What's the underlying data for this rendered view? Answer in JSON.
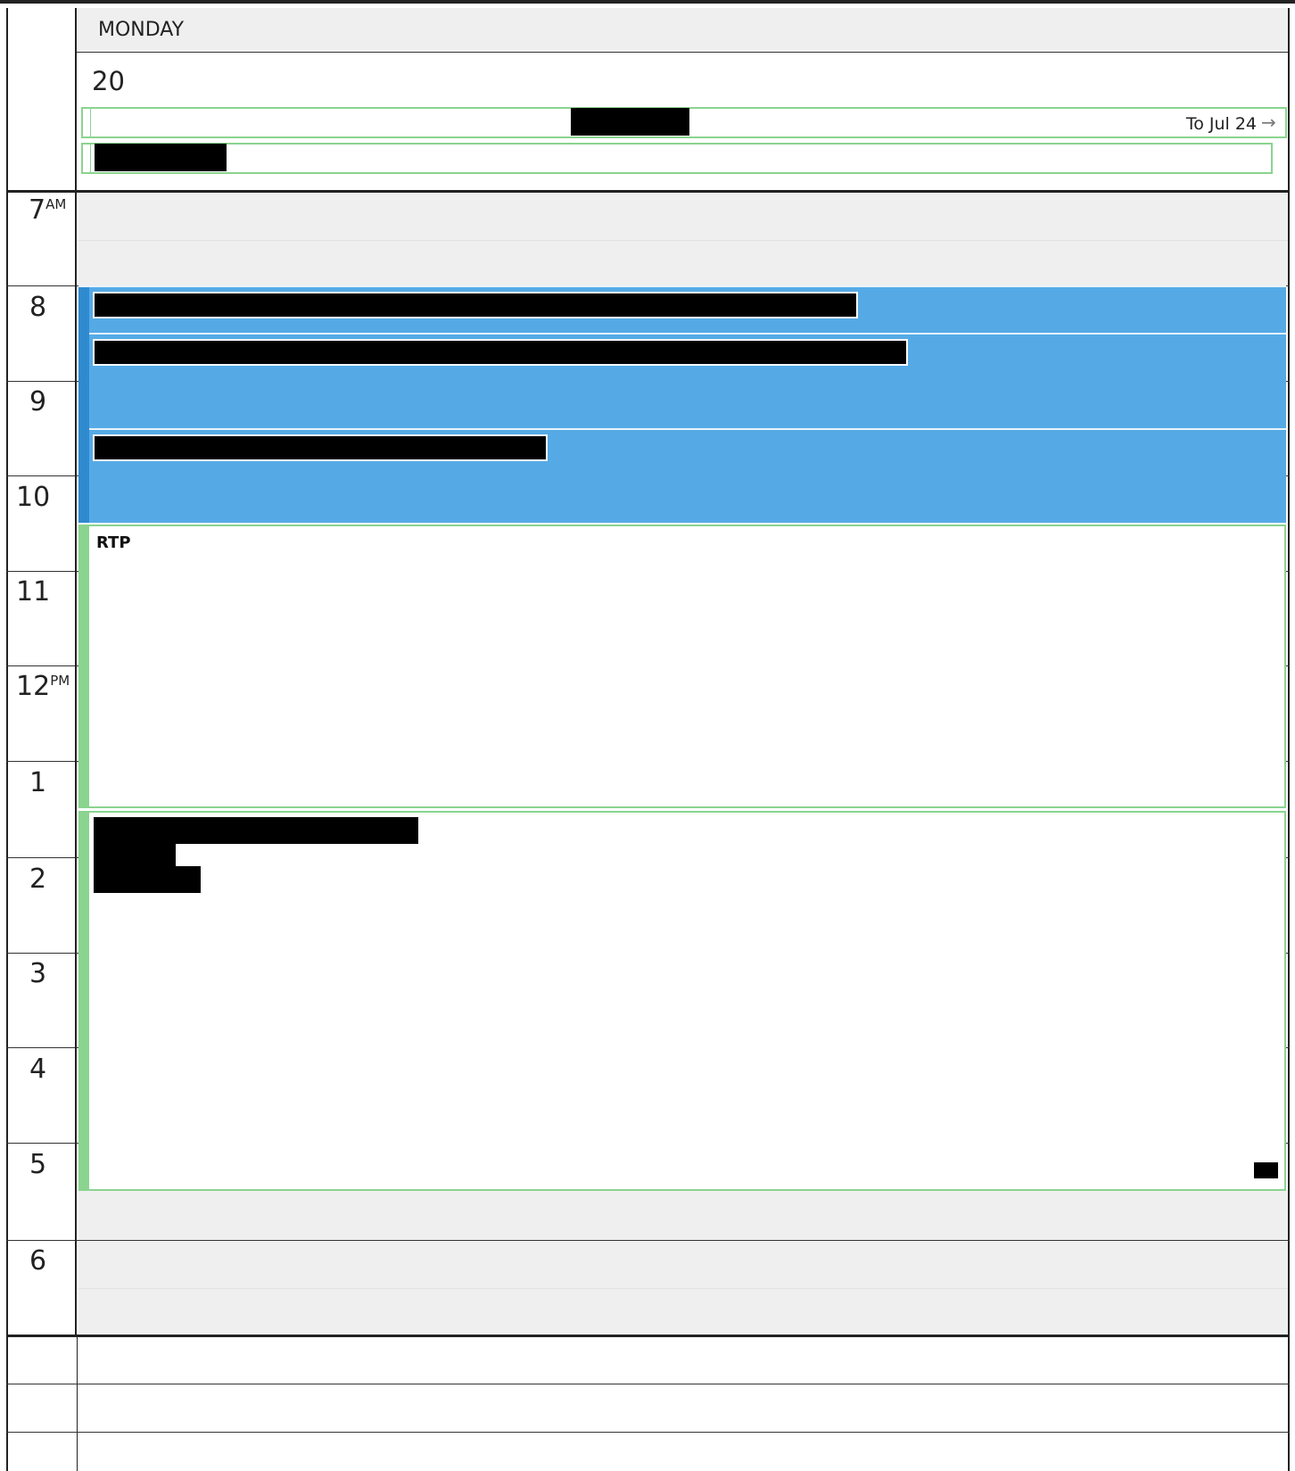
{
  "header": {
    "day_name": "MONDAY",
    "day_number": "20",
    "all_day_events": [
      {
        "title": "",
        "continues_to": "To Jul 24",
        "arrow": "→"
      },
      {
        "title": ""
      }
    ]
  },
  "time_slots": [
    {
      "hour": "7",
      "suffix": "AM"
    },
    {
      "hour": "8",
      "suffix": ""
    },
    {
      "hour": "9",
      "suffix": ""
    },
    {
      "hour": "10",
      "suffix": ""
    },
    {
      "hour": "11",
      "suffix": ""
    },
    {
      "hour": "12",
      "suffix": "PM"
    },
    {
      "hour": "1",
      "suffix": ""
    },
    {
      "hour": "2",
      "suffix": ""
    },
    {
      "hour": "3",
      "suffix": ""
    },
    {
      "hour": "4",
      "suffix": ""
    },
    {
      "hour": "5",
      "suffix": ""
    },
    {
      "hour": "6",
      "suffix": ""
    }
  ],
  "events": [
    {
      "title": "",
      "style": "busy"
    },
    {
      "title": "",
      "style": "busy"
    },
    {
      "title": "",
      "style": "busy"
    },
    {
      "title": "RTP",
      "style": "free"
    },
    {
      "title": "",
      "style": "free"
    }
  ],
  "colors": {
    "busy_fill": "#55aae6",
    "busy_strip": "#2f8ad0",
    "free_border": "#8ad48f",
    "off_hours_band": "#efefef"
  }
}
